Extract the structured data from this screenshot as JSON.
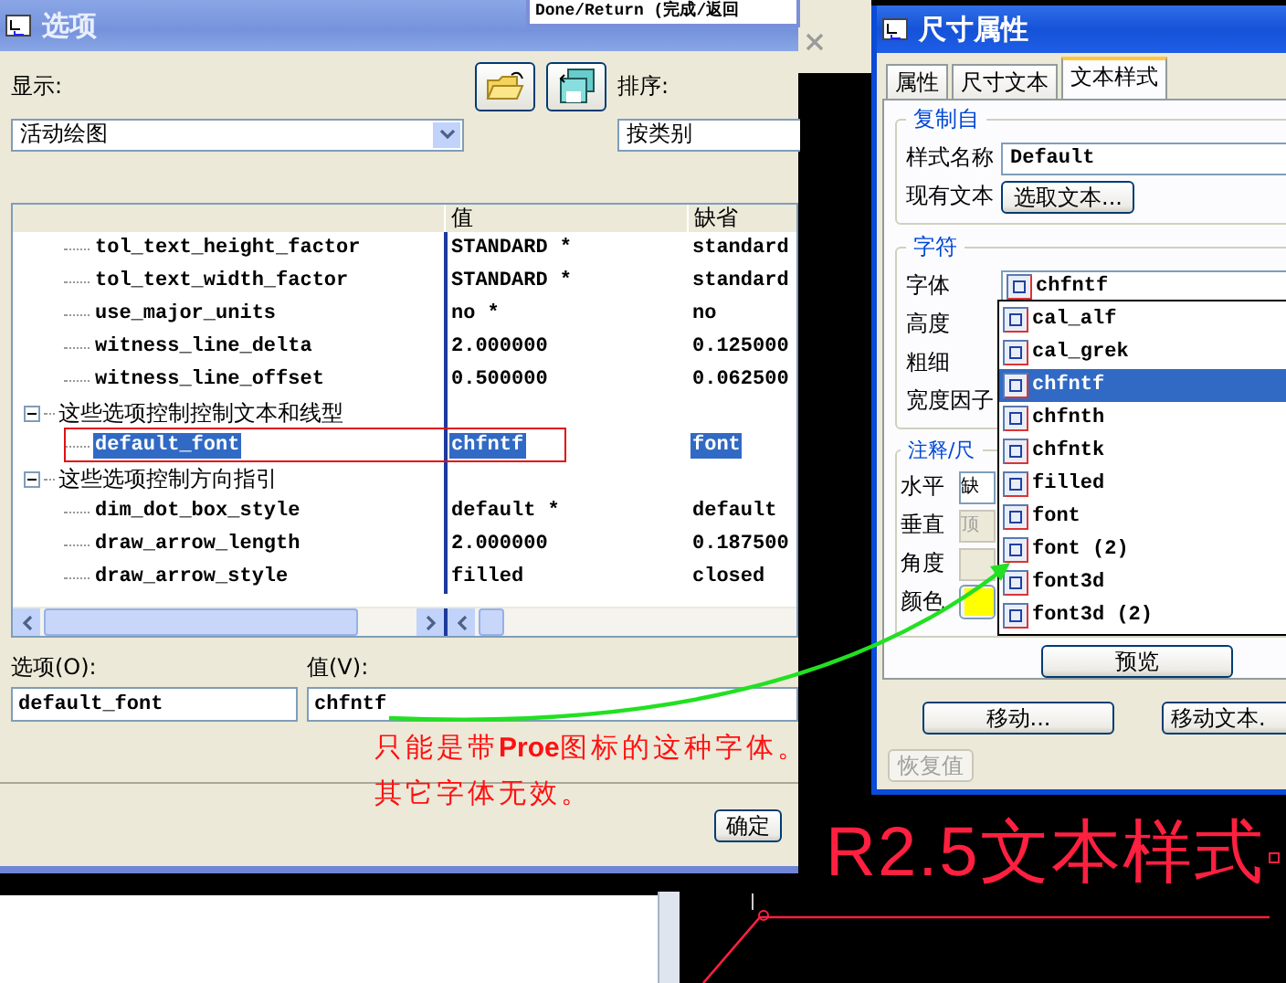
{
  "background_menu": {
    "text": "Done/Return (完成/返回"
  },
  "options_dialog": {
    "title": "选项",
    "show_label": "显示:",
    "show_value": "活动绘图",
    "sort_label": "排序:",
    "sort_value": "按类别",
    "columns": [
      "值",
      "缺省"
    ],
    "rows": [
      {
        "kind": "option",
        "name": "tol_text_height_factor",
        "value": "STANDARD *",
        "default": "standard",
        "selected": false,
        "marked": false
      },
      {
        "kind": "option",
        "name": "tol_text_width_factor",
        "value": "STANDARD *",
        "default": "standard",
        "selected": false,
        "marked": false
      },
      {
        "kind": "option",
        "name": "use_major_units",
        "value": "no *",
        "default": "no",
        "selected": false,
        "marked": false
      },
      {
        "kind": "option",
        "name": "witness_line_delta",
        "value": "2.000000",
        "default": "0.125000",
        "selected": false,
        "marked": false
      },
      {
        "kind": "option",
        "name": "witness_line_offset",
        "value": "0.500000",
        "default": "0.062500",
        "selected": false,
        "marked": false
      },
      {
        "kind": "group",
        "label": "这些选项控制控制文本和线型",
        "expanded": true,
        "children": [
          {
            "kind": "option",
            "name": "default_font",
            "value": "chfntf",
            "default": "font",
            "selected": true,
            "marked": true
          }
        ]
      },
      {
        "kind": "group",
        "label": "这些选项控制方向指引",
        "expanded": true,
        "children": [
          {
            "kind": "option",
            "name": "dim_dot_box_style",
            "value": "default *",
            "default": "default",
            "selected": false,
            "marked": false
          },
          {
            "kind": "option",
            "name": "draw_arrow_length",
            "value": "2.000000",
            "default": "0.187500",
            "selected": false,
            "marked": false
          },
          {
            "kind": "option",
            "name": "draw_arrow_style",
            "value": "filled",
            "default": "closed",
            "selected": false,
            "marked": false
          }
        ]
      }
    ],
    "option_label": "选项(O):",
    "option_value": "default_font",
    "value_label": "值(V):",
    "value_value": "chfntf",
    "ok_button": "确定"
  },
  "note": {
    "lines": [
      "只能是带**Proe**图标的这种字体。",
      "其它字体无效。"
    ]
  },
  "dim_dialog": {
    "title": "尺寸属性",
    "tabs": [
      {
        "label": "属性",
        "selected": false
      },
      {
        "label": "尺寸文本",
        "selected": false
      },
      {
        "label": "文本样式",
        "selected": true
      }
    ],
    "copy_from": {
      "title": "复制自",
      "style_name_label": "样式名称",
      "style_name": "Default",
      "existing_text_label": "现有文本",
      "pick_button": "选取文本..."
    },
    "chars": {
      "title": "字符",
      "font_label": "字体",
      "font_value": "chfntf",
      "height_label": "高度",
      "thickness_label": "粗细",
      "width_factor_label": "宽度因子"
    },
    "font_list": [
      {
        "label": "cal_alf",
        "selected": false
      },
      {
        "label": "cal_grek",
        "selected": false
      },
      {
        "label": "chfntf",
        "selected": true
      },
      {
        "label": "chfnth",
        "selected": false
      },
      {
        "label": "chfntk",
        "selected": false
      },
      {
        "label": "filled",
        "selected": false
      },
      {
        "label": "font",
        "selected": false
      },
      {
        "label": "font (2)",
        "selected": false
      },
      {
        "label": "font3d",
        "selected": false
      },
      {
        "label": "font3d (2)",
        "selected": false
      }
    ],
    "note_group": {
      "title": "注释/尺",
      "horizontal_label": "水平",
      "horizontal": {
        "value": "缺",
        "disabled": false
      },
      "vertical_label": "垂直",
      "vertical": {
        "value": "顶",
        "disabled": true
      },
      "angle_label": "角度",
      "color_label": "颜色",
      "color": "#ffff00"
    },
    "preview_button": "预览",
    "move_button": "移动...",
    "move_text_button": "移动文本.",
    "restore_button": {
      "label": "恢复值",
      "disabled": true
    }
  },
  "drawing": {
    "dimension_text": "R2.5文本样式"
  }
}
